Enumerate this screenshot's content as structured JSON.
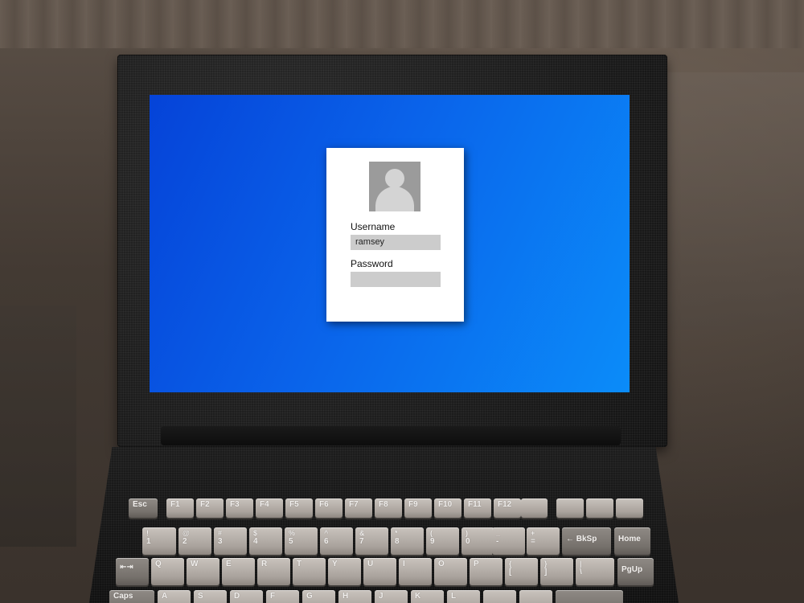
{
  "login": {
    "username_label": "Username",
    "username_value": "ramsey",
    "password_label": "Password",
    "password_value": ""
  },
  "keyboard": {
    "row_fn": [
      "Esc",
      "F1",
      "F2",
      "F3",
      "F4",
      "F5",
      "F6",
      "F7",
      "F8",
      "F9",
      "F10",
      "F11",
      "F12"
    ],
    "row_num": [
      {
        "top": "!",
        "bot": "1"
      },
      {
        "top": "@",
        "bot": "2"
      },
      {
        "top": "#",
        "bot": "3"
      },
      {
        "top": "$",
        "bot": "4"
      },
      {
        "top": "%",
        "bot": "5"
      },
      {
        "top": "^",
        "bot": "6"
      },
      {
        "top": "&",
        "bot": "7"
      },
      {
        "top": "*",
        "bot": "8"
      },
      {
        "top": "(",
        "bot": "9"
      },
      {
        "top": ")",
        "bot": "0"
      },
      {
        "top": "_",
        "bot": "-"
      },
      {
        "top": "+",
        "bot": "="
      }
    ],
    "backspace": "← BkSp",
    "home": "Home",
    "row_q": [
      "Q",
      "W",
      "E",
      "R",
      "T",
      "Y",
      "U",
      "I",
      "O",
      "P"
    ],
    "bracket_left": {
      "top": "{",
      "bot": "["
    },
    "bracket_right": {
      "top": "}",
      "bot": "]"
    },
    "pipe": {
      "top": "|",
      "bot": "\\"
    },
    "pgup": "PgUp",
    "tab_glyph": "⇤⇥",
    "row_a": [
      "A",
      "S",
      "D",
      "F",
      "G",
      "H",
      "J",
      "K",
      "L"
    ],
    "caps": "Caps"
  }
}
